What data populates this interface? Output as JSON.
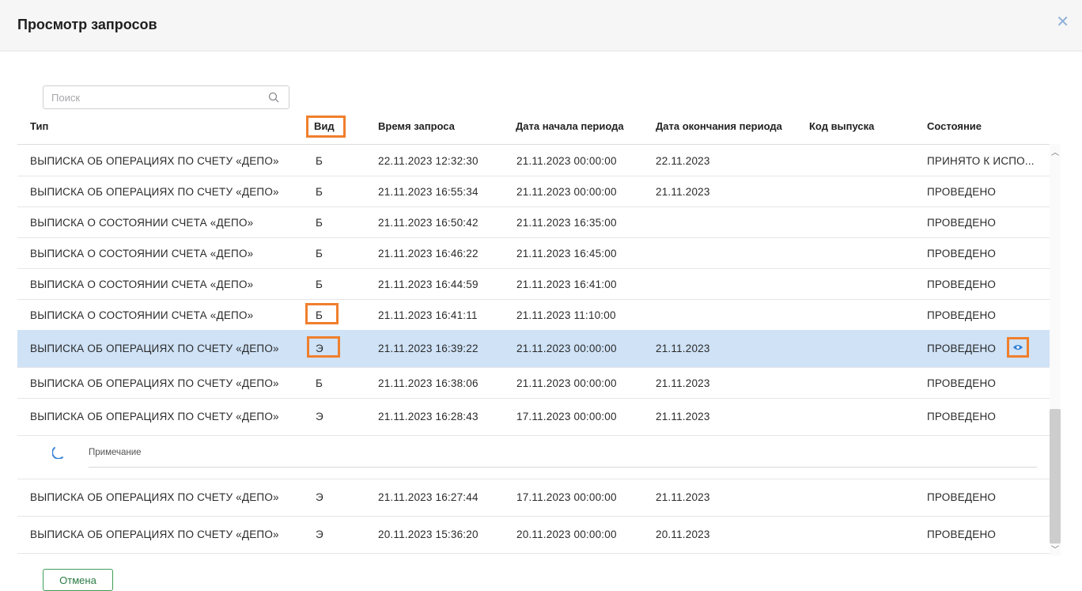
{
  "dialog": {
    "title": "Просмотр запросов",
    "close_icon": "close-icon"
  },
  "search": {
    "placeholder": "Поиск",
    "value": "",
    "icon": "search-icon"
  },
  "columns": [
    "Тип",
    "Вид",
    "Время запроса",
    "Дата начала периода",
    "Дата окончания периода",
    "Код выпуска",
    "Состояние"
  ],
  "rows": [
    {
      "type": "ВЫПИСКА ОБ ОПЕРАЦИЯХ ПО СЧЕТУ «ДЕПО»",
      "kind": "Б",
      "time": "22.11.2023 12:32:30",
      "start": "21.11.2023 00:00:00",
      "end": "22.11.2023",
      "code": "",
      "state": "ПРИНЯТО К ИСПО..."
    },
    {
      "type": "ВЫПИСКА ОБ ОПЕРАЦИЯХ ПО СЧЕТУ «ДЕПО»",
      "kind": "Б",
      "time": "21.11.2023 16:55:34",
      "start": "21.11.2023 00:00:00",
      "end": "21.11.2023",
      "code": "",
      "state": "ПРОВЕДЕНО"
    },
    {
      "type": "ВЫПИСКА О СОСТОЯНИИ СЧЕТА «ДЕПО»",
      "kind": "Б",
      "time": "21.11.2023 16:50:42",
      "start": "21.11.2023 16:35:00",
      "end": "",
      "code": "",
      "state": "ПРОВЕДЕНО"
    },
    {
      "type": "ВЫПИСКА О СОСТОЯНИИ СЧЕТА «ДЕПО»",
      "kind": "Б",
      "time": "21.11.2023 16:46:22",
      "start": "21.11.2023 16:45:00",
      "end": "",
      "code": "",
      "state": "ПРОВЕДЕНО"
    },
    {
      "type": "ВЫПИСКА О СОСТОЯНИИ СЧЕТА «ДЕПО»",
      "kind": "Б",
      "time": "21.11.2023 16:44:59",
      "start": "21.11.2023 16:41:00",
      "end": "",
      "code": "",
      "state": "ПРОВЕДЕНО"
    },
    {
      "type": "ВЫПИСКА О СОСТОЯНИИ СЧЕТА «ДЕПО»",
      "kind": "Б",
      "time": "21.11.2023 16:41:11",
      "start": "21.11.2023 11:10:00",
      "end": "",
      "code": "",
      "state": "ПРОВЕДЕНО"
    },
    {
      "type": "ВЫПИСКА ОБ ОПЕРАЦИЯХ ПО СЧЕТУ «ДЕПО»",
      "kind": "Э",
      "time": "21.11.2023 16:39:22",
      "start": "21.11.2023 00:00:00",
      "end": "21.11.2023",
      "code": "",
      "state": "ПРОВЕДЕНО",
      "selected": true
    },
    {
      "type": "ВЫПИСКА ОБ ОПЕРАЦИЯХ ПО СЧЕТУ «ДЕПО»",
      "kind": "Б",
      "time": "21.11.2023 16:38:06",
      "start": "21.11.2023 00:00:00",
      "end": "21.11.2023",
      "code": "",
      "state": "ПРОВЕДЕНО"
    },
    {
      "type": "ВЫПИСКА ОБ ОПЕРАЦИЯХ ПО СЧЕТУ «ДЕПО»",
      "kind": "Э",
      "time": "21.11.2023 16:28:43",
      "start": "17.11.2023 00:00:00",
      "end": "21.11.2023",
      "code": "",
      "state": "ПРОВЕДЕНО"
    },
    {
      "type": "ВЫПИСКА ОБ ОПЕРАЦИЯХ ПО СЧЕТУ «ДЕПО»",
      "kind": "Э",
      "time": "21.11.2023 16:27:44",
      "start": "17.11.2023 00:00:00",
      "end": "21.11.2023",
      "code": "",
      "state": "ПРОВЕДЕНО"
    },
    {
      "type": "ВЫПИСКА ОБ ОПЕРАЦИЯХ ПО СЧЕТУ «ДЕПО»",
      "kind": "Э",
      "time": "20.11.2023 15:36:20",
      "start": "20.11.2023 00:00:00",
      "end": "20.11.2023",
      "code": "",
      "state": "ПРОВЕДЕНО"
    }
  ],
  "note": {
    "label": "Примечание",
    "value": ""
  },
  "row_action_icon": "eye-icon",
  "buttons": {
    "cancel": "Отмена"
  },
  "colors": {
    "selected_row": "#cfe2f6",
    "highlight": "#f07f2c",
    "accent": "#3f9d58",
    "close": "#8fb0d9"
  }
}
